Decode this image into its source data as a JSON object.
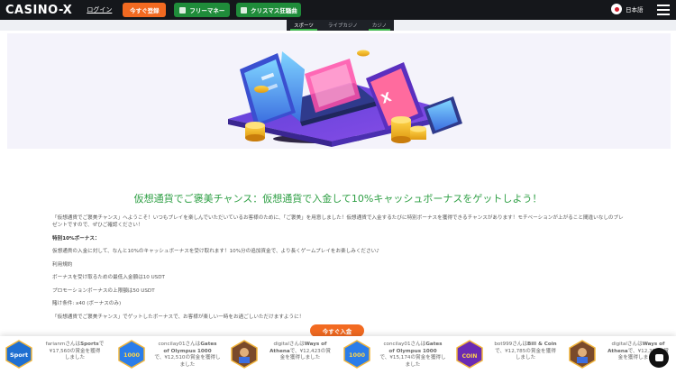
{
  "header": {
    "logo": "CASINO-X",
    "login": "ログイン",
    "register": "今すぐ登録",
    "free_money": "フリーマネー",
    "christmas": "クリスマス狂騒曲",
    "language": "日本語"
  },
  "subnav": {
    "tabs": [
      {
        "label": "スポーツ"
      },
      {
        "label": "ライブカジノ"
      },
      {
        "label": "カジノ"
      }
    ]
  },
  "content": {
    "heading": "仮想通貨でご褒美チャンス：仮想通貨で入金して10%キャッシュボーナスをゲットしよう！",
    "intro": "「仮想通貨でご褒美チャンス」へようこそ！いつもプレイを楽しんでいただいているお客様のために、「ご褒美」を用意しました！仮想通貨で入金するたびに特別ボーナスを獲得できるチャンスがあります！モチベーションが上がること間違いなしのプレゼントですので、ぜひご確認ください！",
    "bonus_title": "特別10%ボーナス：",
    "bonus_desc": "仮想通貨の入金に対して、なんと10%のキャッシュボーナスを受け取れます！10%分の追加資金で、より長くゲームプレイをお楽しみください♪",
    "terms_title": "利用規約",
    "min_deposit": "ボーナスを受け取るための最低入金額は10 USDT",
    "max_bonus": "プロモーションボーナスの上限額は50 USDT",
    "wagering": "賭け条件: x40 (ボーナスのみ)",
    "closing": "「仮想通貨でご褒美チャンス」でゲットしたボーナスで、お客様が楽しい一時をお過ごしいただけますように！",
    "cta": "今すぐ入金"
  },
  "winners": [
    {
      "line1": "farianmさんは",
      "game": "Sports",
      "line2": "で",
      "line3": "¥17,560の賞金を獲得",
      "line4": "しました",
      "thumb_color": "#1f6fd1",
      "thumb_label": "Sport"
    },
    {
      "line1": "concilay01さんは",
      "game": "Gates",
      "line2": "of Olympus 1000",
      "line3": "で、¥12,510の賞金を獲得し",
      "line4": "ました",
      "thumb_color": "#2b7de9",
      "thumb_label": "1000"
    },
    {
      "line1": "digitalさんは",
      "game": "Ways of",
      "line2": "Athena",
      "line3": "で、¥12,423の賞",
      "line4": "金を獲得しました",
      "thumb_color": "#7a4a2b",
      "thumb_label": ""
    },
    {
      "line1": "concilay01さんは",
      "game": "Gates",
      "line2": "of Olympus 1000",
      "line3": "で、¥15,174の賞金を獲得し",
      "line4": "ました",
      "thumb_color": "#2b7de9",
      "thumb_label": "1000"
    },
    {
      "line1": "bot999さんは",
      "game": "Bill & Coin",
      "line2": "で、¥12,785の賞金を獲得",
      "line3": "しました",
      "line4": "",
      "thumb_color": "#6a2bb3",
      "thumb_label": "COIN"
    },
    {
      "line1": "digitalさんは",
      "game": "Ways of",
      "line2": "Athena",
      "line3": "で、¥12,398の賞",
      "line4": "金を獲得しました",
      "thumb_color": "#7a4a2b",
      "thumb_label": ""
    }
  ],
  "colors": {
    "header_bg": "#15171b",
    "accent_orange": "#f26a21",
    "accent_green": "#1f8c3a",
    "heading_green": "#2e9f44"
  }
}
